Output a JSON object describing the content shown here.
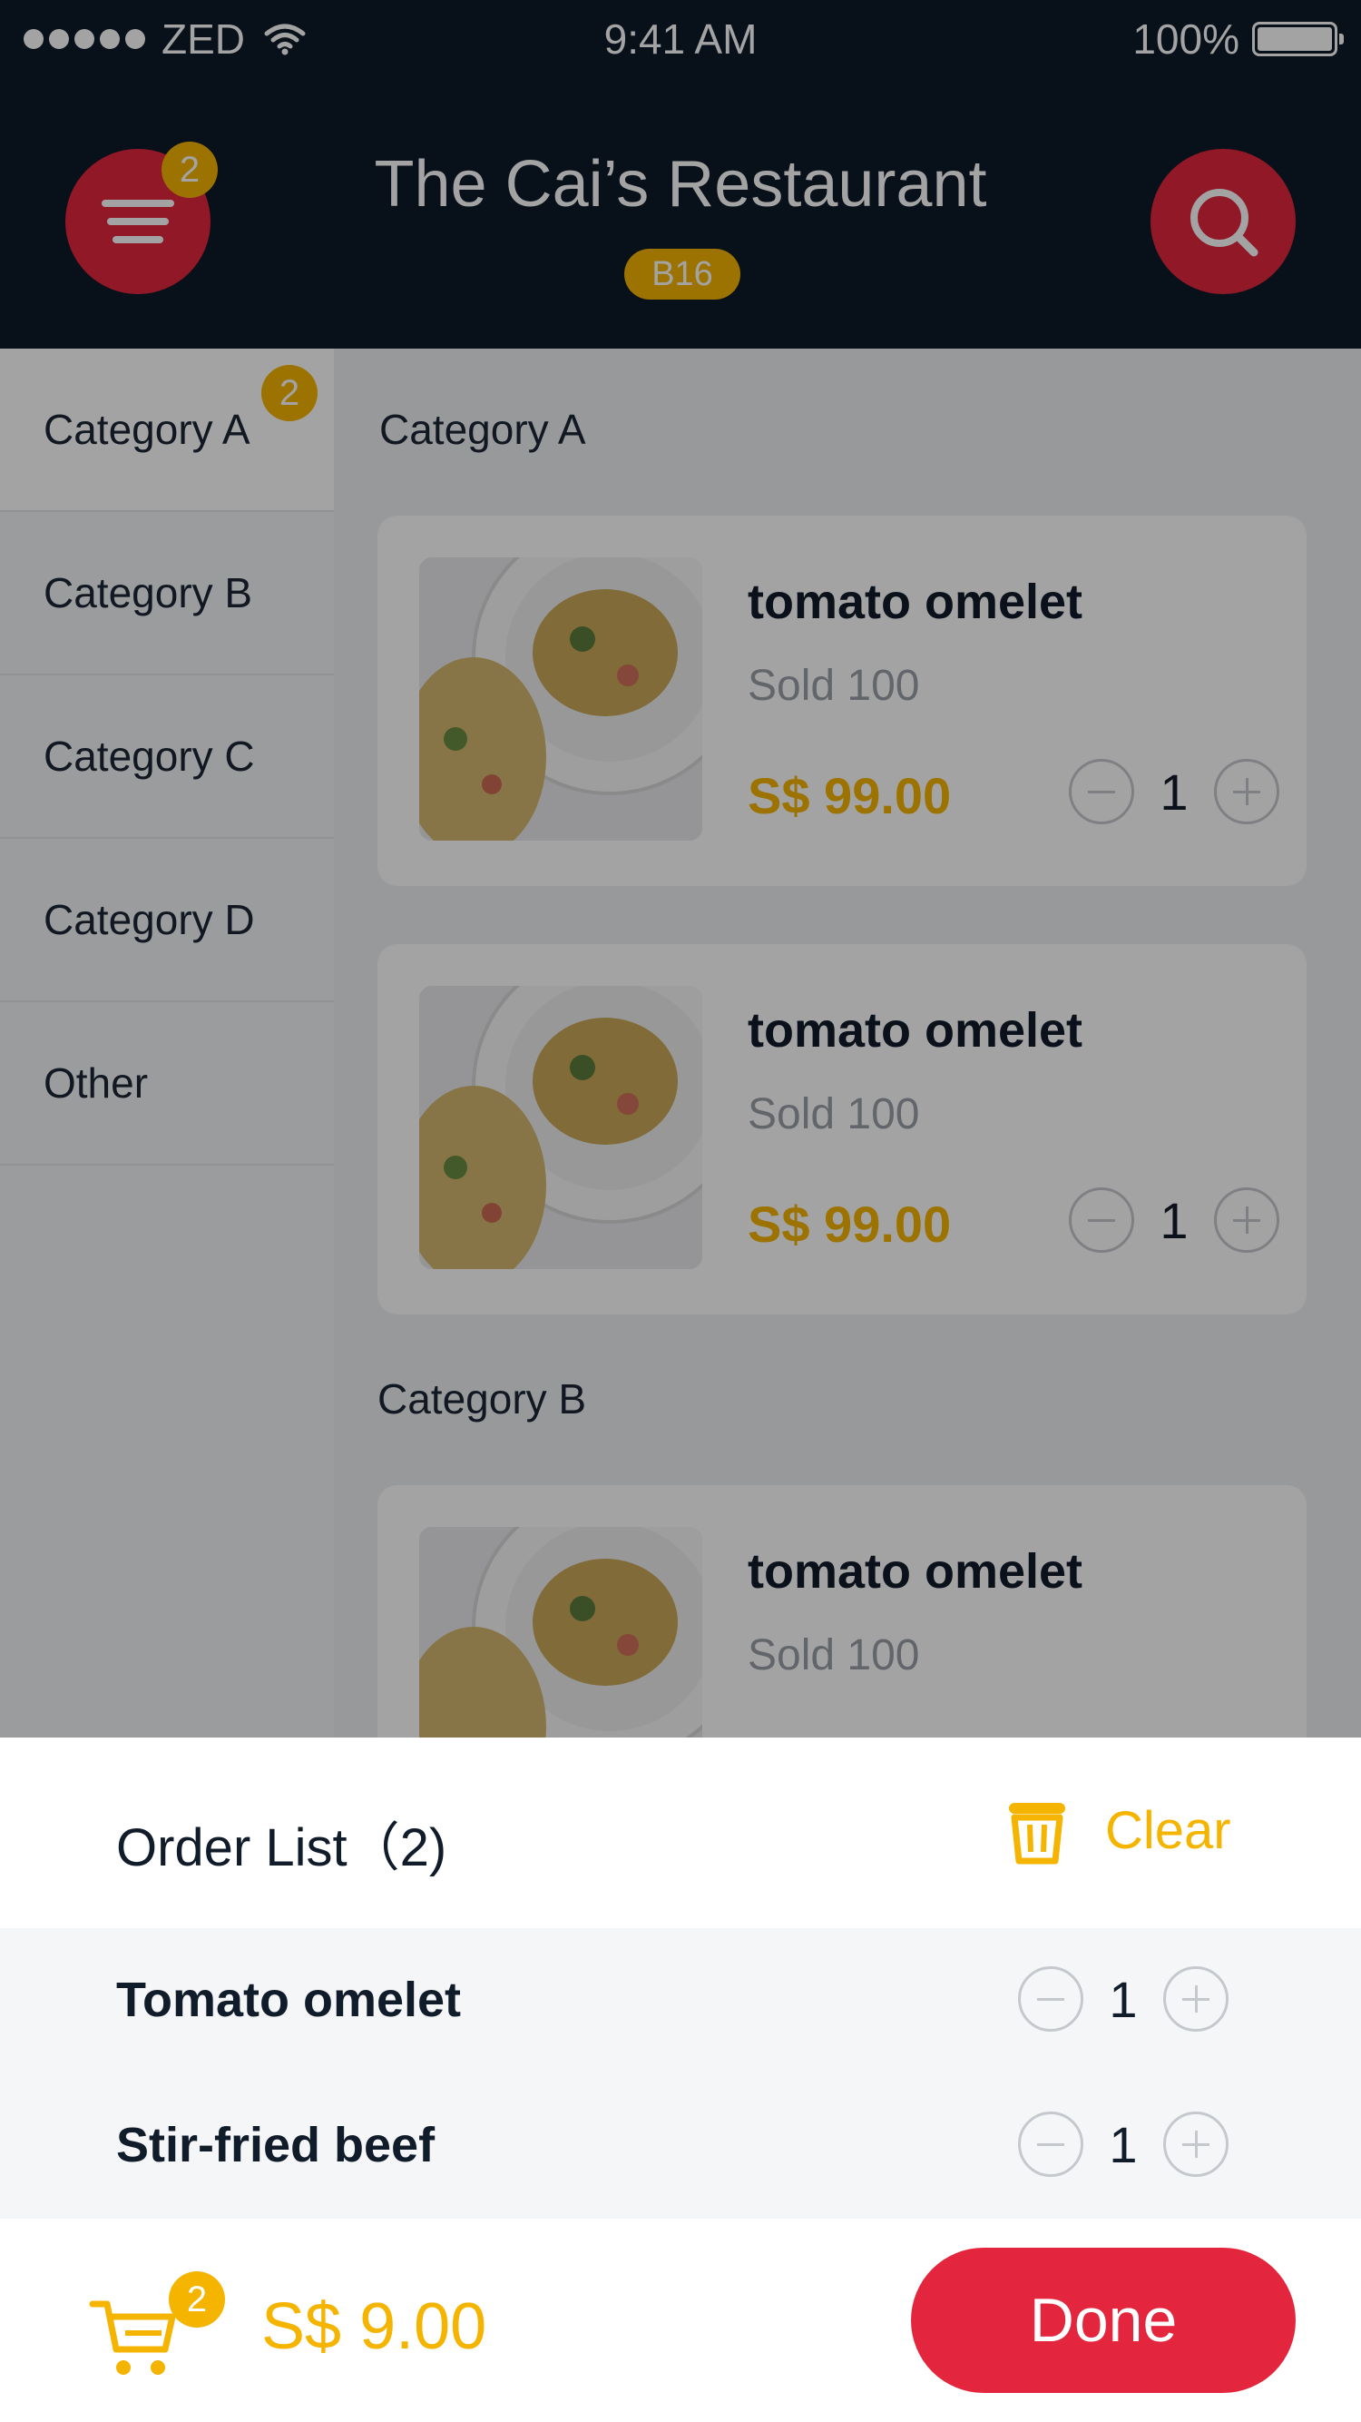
{
  "status_bar": {
    "carrier": "ZED",
    "time": "9:41 AM",
    "battery": "100%"
  },
  "header": {
    "menu_badge": "2",
    "title": "The Cai’s Restaurant",
    "table_tag": "B16"
  },
  "sidebar": {
    "items": [
      {
        "label": "Category A",
        "badge": "2"
      },
      {
        "label": "Category B"
      },
      {
        "label": "Category C"
      },
      {
        "label": "Category D"
      },
      {
        "label": "Other"
      }
    ]
  },
  "menu": {
    "sections": [
      {
        "title": "Category A",
        "items": [
          {
            "name": "tomato omelet",
            "sold": "Sold 100",
            "price": "S$ 99.00",
            "quantity": "1"
          },
          {
            "name": "tomato omelet",
            "sold": "Sold 100",
            "price": "S$ 99.00",
            "quantity": "1"
          }
        ]
      },
      {
        "title": "Category B",
        "items": [
          {
            "name": "tomato omelet",
            "sold": "Sold 100"
          }
        ]
      }
    ]
  },
  "order_sheet": {
    "title": "Order List（2)",
    "clear_label": "Clear",
    "items": [
      {
        "name": "Tomato omelet",
        "quantity": "1"
      },
      {
        "name": "Stir-fried beef",
        "quantity": "1"
      }
    ]
  },
  "bottom_bar": {
    "cart_badge": "2",
    "total": "S$ 9.00",
    "done_label": "Done"
  },
  "colors": {
    "accent_red": "#e3263e",
    "accent_yellow": "#f4b400",
    "header_bg": "#0d1a29"
  },
  "icons": [
    "menu-icon",
    "search-icon",
    "wifi-icon",
    "battery-icon",
    "trash-icon",
    "cart-icon",
    "minus-icon",
    "plus-icon"
  ]
}
